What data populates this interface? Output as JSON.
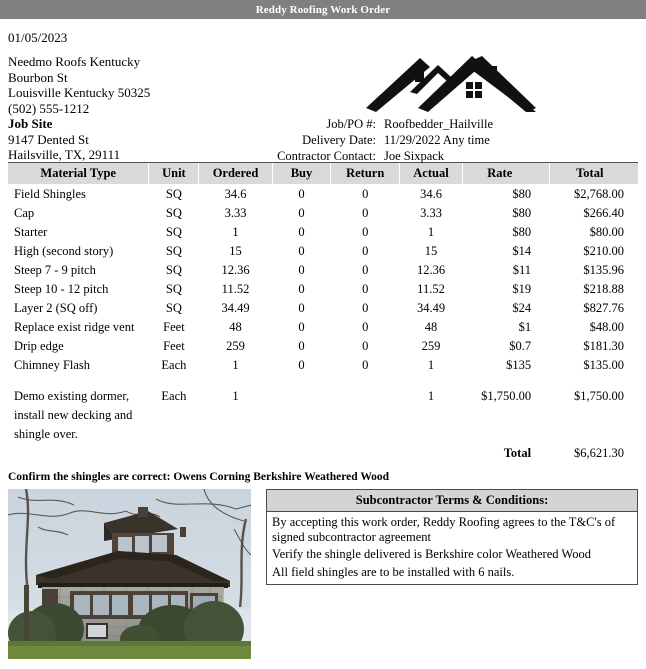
{
  "titlebar": {
    "title": "Reddy Roofing Work Order"
  },
  "document": {
    "date": "01/05/2023"
  },
  "company": {
    "name": "Needmo Roofs Kentucky",
    "street": "Bourbon St",
    "city_state_zip": "Louisville Kentucky 50325",
    "phone": "(502) 555-1212"
  },
  "job_site": {
    "heading": "Job Site",
    "street": "9147 Dented St",
    "city_state_zip": "Hailsville, TX, 29111"
  },
  "meta": {
    "job_po_label": "Job/PO #:",
    "job_po_value": "Roofbedder_Hailville",
    "delivery_date_label": "Delivery Date:",
    "delivery_date_value": "11/29/2022 Any time",
    "contractor_contact_label": "Contractor Contact:",
    "contractor_contact_value": "Joe Sixpack"
  },
  "table": {
    "headers": [
      "Material Type",
      "Unit",
      "Ordered",
      "Buy",
      "Return",
      "Actual",
      "Rate",
      "Total"
    ],
    "rows": [
      {
        "material": "Field Shingles",
        "unit": "SQ",
        "ordered": "34.6",
        "buy": "0",
        "return": "0",
        "actual": "34.6",
        "rate": "$80",
        "total": "$2,768.00"
      },
      {
        "material": "Cap",
        "unit": "SQ",
        "ordered": "3.33",
        "buy": "0",
        "return": "0",
        "actual": "3.33",
        "rate": "$80",
        "total": "$266.40"
      },
      {
        "material": "Starter",
        "unit": "SQ",
        "ordered": "1",
        "buy": "0",
        "return": "0",
        "actual": "1",
        "rate": "$80",
        "total": "$80.00"
      },
      {
        "material": "High (second story)",
        "unit": "SQ",
        "ordered": "15",
        "buy": "0",
        "return": "0",
        "actual": "15",
        "rate": "$14",
        "total": "$210.00"
      },
      {
        "material": "Steep 7 - 9 pitch",
        "unit": "SQ",
        "ordered": "12.36",
        "buy": "0",
        "return": "0",
        "actual": "12.36",
        "rate": "$11",
        "total": "$135.96"
      },
      {
        "material": "Steep 10 - 12 pitch",
        "unit": "SQ",
        "ordered": "11.52",
        "buy": "0",
        "return": "0",
        "actual": "11.52",
        "rate": "$19",
        "total": "$218.88"
      },
      {
        "material": "Layer 2 (SQ off)",
        "unit": "SQ",
        "ordered": "34.49",
        "buy": "0",
        "return": "0",
        "actual": "34.49",
        "rate": "$24",
        "total": "$827.76"
      },
      {
        "material": "Replace exist ridge vent",
        "unit": "Feet",
        "ordered": "48",
        "buy": "0",
        "return": "0",
        "actual": "48",
        "rate": "$1",
        "total": "$48.00"
      },
      {
        "material": "Drip edge",
        "unit": "Feet",
        "ordered": "259",
        "buy": "0",
        "return": "0",
        "actual": "259",
        "rate": "$0.7",
        "total": "$181.30"
      },
      {
        "material": "Chimney Flash",
        "unit": "Each",
        "ordered": "1",
        "buy": "0",
        "return": "0",
        "actual": "1",
        "rate": "$135",
        "total": "$135.00"
      }
    ],
    "note_row": {
      "material_line1": "Demo existing dormer,",
      "material_line2": "install new decking and",
      "material_line3": "shingle over.",
      "unit": "Each",
      "ordered": "1",
      "buy": "",
      "return": "",
      "actual": "1",
      "rate": "$1,750.00",
      "total": "$1,750.00"
    },
    "grand_total_label": "Total",
    "grand_total_value": "$6,621.30"
  },
  "confirm_line": "Confirm the shingles are correct: Owens Corning Berkshire Weathered Wood",
  "terms": {
    "title": "Subcontractor Terms & Conditions:",
    "lines": [
      "By accepting this work order, Reddy Roofing agrees to the T&C's of signed subcontractor agreement",
      "Verify the shingle delivered is Berkshire color Weathered Wood",
      "All field shingles are to be installed with 6 nails."
    ]
  },
  "colors": {
    "titlebar_bg": "#808080",
    "table_header_bg": "#d9d9d9",
    "terms_header_bg": "#d4d4d4",
    "border": "#4a4a4a"
  }
}
